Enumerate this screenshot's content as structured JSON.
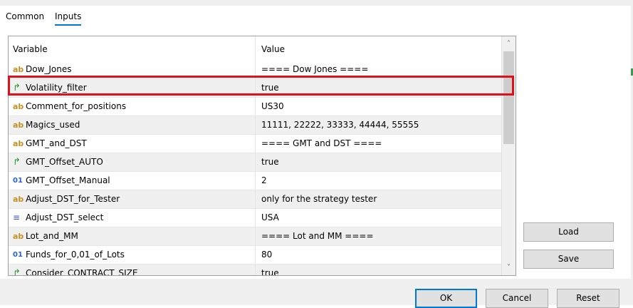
{
  "tabs": {
    "common": "Common",
    "inputs": "Inputs",
    "active": "Inputs"
  },
  "grid": {
    "headers": {
      "variable": "Variable",
      "value": "Value"
    },
    "rows": [
      {
        "icon": "ab",
        "name": "Dow_Jones",
        "value": "==== Dow Jones ===="
      },
      {
        "icon": "bool",
        "name": "Volatility_filter",
        "value": "true",
        "selected": true
      },
      {
        "icon": "ab",
        "name": "Comment_for_positions",
        "value": "US30"
      },
      {
        "icon": "ab",
        "name": "Magics_used",
        "value": "11111, 22222, 33333, 44444, 55555"
      },
      {
        "icon": "ab",
        "name": "GMT_and_DST",
        "value": "==== GMT and DST ===="
      },
      {
        "icon": "bool",
        "name": "GMT_Offset_AUTO",
        "value": "true"
      },
      {
        "icon": "num",
        "name": "GMT_Offset_Manual",
        "value": "2"
      },
      {
        "icon": "ab",
        "name": "Adjust_DST_for_Tester",
        "value": "only for the strategy tester"
      },
      {
        "icon": "enum",
        "name": "Adjust_DST_select",
        "value": "USA"
      },
      {
        "icon": "ab",
        "name": "Lot_and_MM",
        "value": "==== Lot and MM ===="
      },
      {
        "icon": "num",
        "name": "Funds_for_0,01_of_Lots",
        "value": "80"
      },
      {
        "icon": "bool",
        "name": "Consider_CONTRACT_SIZE",
        "value": "true"
      }
    ]
  },
  "icons": {
    "ab": "ab",
    "bool": "↱",
    "num": "01",
    "enum": "≡"
  },
  "buttons": {
    "load": "Load",
    "save": "Save",
    "ok": "OK",
    "cancel": "Cancel",
    "reset": "Reset"
  },
  "colors": {
    "highlight": "#e0101a",
    "accent": "#0078d7"
  }
}
